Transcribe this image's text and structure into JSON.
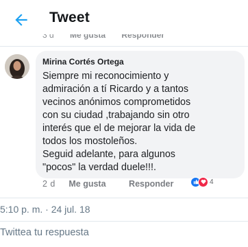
{
  "header": {
    "title": "Tweet"
  },
  "previous_comment": {
    "time": "3 d",
    "like_label": "Me gusta",
    "reply_label": "Responder"
  },
  "comment": {
    "author": "Mirina Cortés Ortega",
    "text": "Siempre mi reconocimiento  y\nadmiración a tí Ricardo y a tantos\nvecinos anónimos comprometidos\ncon su ciudad ,trabajando sin otro\ninterés que el de mejorar la vida de\ntodos los mostoleños.\nSeguid adelante, para algunos\n\"pocos\" la verdad duele!!!.",
    "time": "2 d",
    "like_label": "Me gusta",
    "reply_label": "Responder",
    "reaction_count": "4",
    "reactions": [
      "like-icon",
      "love-icon"
    ]
  },
  "tweet": {
    "timestamp": "5:10 p. m. · 24 jul. 18"
  },
  "reply": {
    "placeholder": "Twittea tu respuesta"
  },
  "colors": {
    "accent": "#1da1f2",
    "like_reaction": "#1877f2",
    "love_reaction": "#f02849"
  }
}
